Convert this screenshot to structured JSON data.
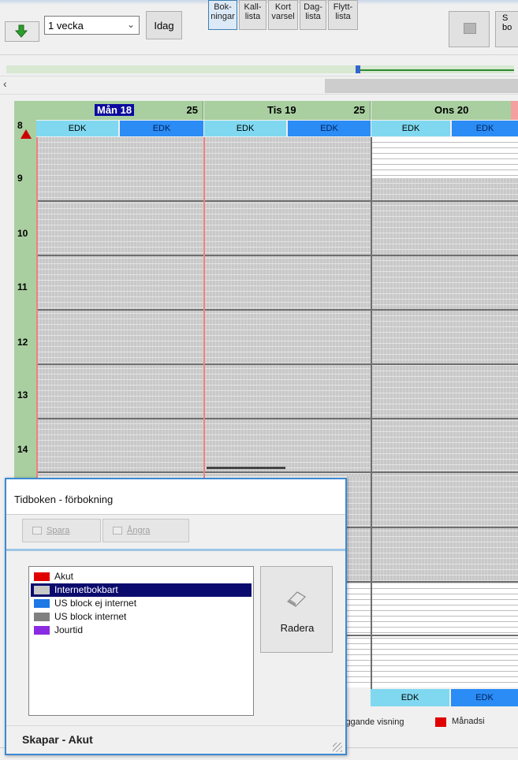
{
  "toolbar": {
    "period_select": "1 vecka",
    "today_label": "Idag",
    "buttons": [
      {
        "label": "Bok-\nningar"
      },
      {
        "label": "Kall-\nlista"
      },
      {
        "label": "Kort\nvarsel"
      },
      {
        "label": "Dag-\nlista"
      },
      {
        "label": "Flytt-\nlista"
      }
    ],
    "cut_button_label": "S\nbo"
  },
  "calendar": {
    "days": [
      {
        "name": "Mån 18",
        "week": "25"
      },
      {
        "name": "Tis 19",
        "week": "25"
      },
      {
        "name": "Ons 20",
        "week": ""
      }
    ],
    "resource_label": "EDK",
    "hours": [
      "8",
      "9",
      "10",
      "11",
      "12",
      "13",
      "14"
    ]
  },
  "legend": {
    "text_left": "iggande visning",
    "text_right": "Månadsi",
    "swatch_color": "#e00000"
  },
  "dialog": {
    "title": "Tidboken - förbokning",
    "save_label": "Spara",
    "undo_label": "Ångra",
    "items": [
      {
        "label": "Akut",
        "color": "#e00000"
      },
      {
        "label": "Internetbokbart",
        "color": "#c8c8c8"
      },
      {
        "label": "US block ej internet",
        "color": "#1e78e6"
      },
      {
        "label": "US block internet",
        "color": "#808080"
      },
      {
        "label": "Jourtid",
        "color": "#8a2be2"
      }
    ],
    "delete_label": "Radera",
    "status": "Skapar - Akut"
  },
  "colors": {
    "header_green": "#a9cfa0",
    "resource_light": "#7fd8f0",
    "resource_dark": "#2a8cf4",
    "selected_list": "#0b0b6e"
  }
}
